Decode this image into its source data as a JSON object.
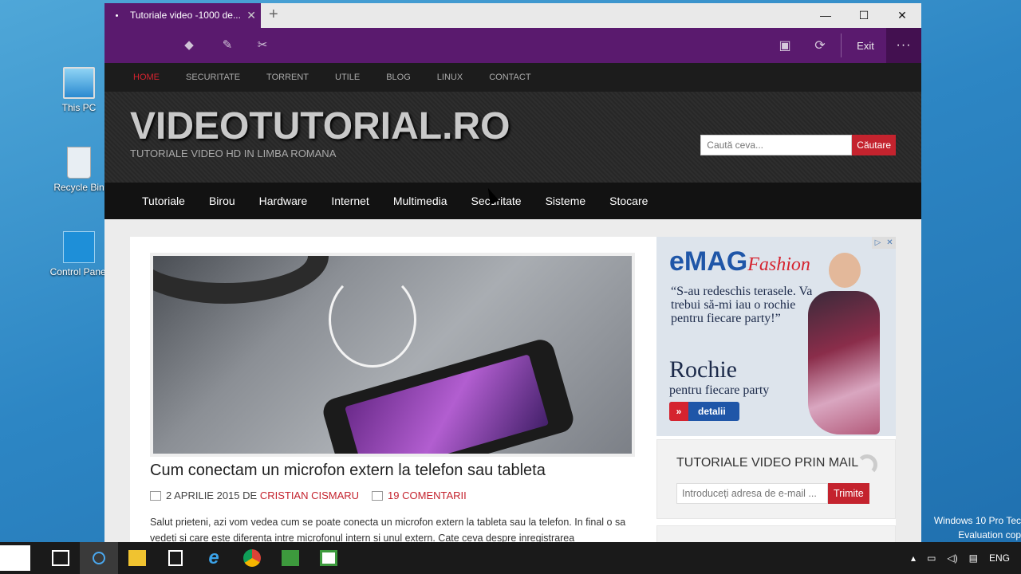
{
  "desktop": {
    "icons": [
      "This PC",
      "Recycle Bin",
      "Control Panel"
    ],
    "watermark": [
      "Windows 10 Pro Tec",
      "Evaluation cop"
    ]
  },
  "browser": {
    "tab_title": "Tutoriale video -1000 de...",
    "exit_label": "Exit",
    "more_label": "···"
  },
  "site": {
    "topnav": [
      "HOME",
      "SECURITATE",
      "TORRENT",
      "UTILE",
      "BLOG",
      "LINUX",
      "CONTACT"
    ],
    "logo": "VIDEOTUTORIAL.RO",
    "tagline": "TUTORIALE VIDEO HD IN LIMBA ROMANA",
    "search": {
      "placeholder": "Caută ceva...",
      "button": "Căutare"
    },
    "catnav": [
      "Tutoriale",
      "Birou",
      "Hardware",
      "Internet",
      "Multimedia",
      "Securitate",
      "Sisteme",
      "Stocare"
    ],
    "post": {
      "title": "Cum conectam un microfon extern la telefon sau tableta",
      "date": "2 APRILIE 2015 DE",
      "author": "CRISTIAN CISMARU",
      "comments": "19 COMENTARII",
      "excerpt": "Salut prieteni, azi vom vedea cum se poate conecta un microfon extern la tableta sau la telefon. In final o sa vedeti si care este diferenta intre microfonul intern si unul extern. Cate ceva despre inregistrarea"
    },
    "ad": {
      "brand": "eMAG",
      "brand_suffix": "Fashion",
      "quote": "“S-au redeschis terasele. Va trebui să-mi iau o rochie pentru fiecare party!”",
      "headline": "Rochie",
      "subline": "pentru fiecare party",
      "button": "detalii"
    },
    "mail": {
      "title": "TUTORIALE VIDEO PRIN MAIL",
      "placeholder": "Introduceți adresa de e-mail ...",
      "button": "Trimite"
    }
  },
  "taskbar": {
    "lang": "ENG"
  }
}
